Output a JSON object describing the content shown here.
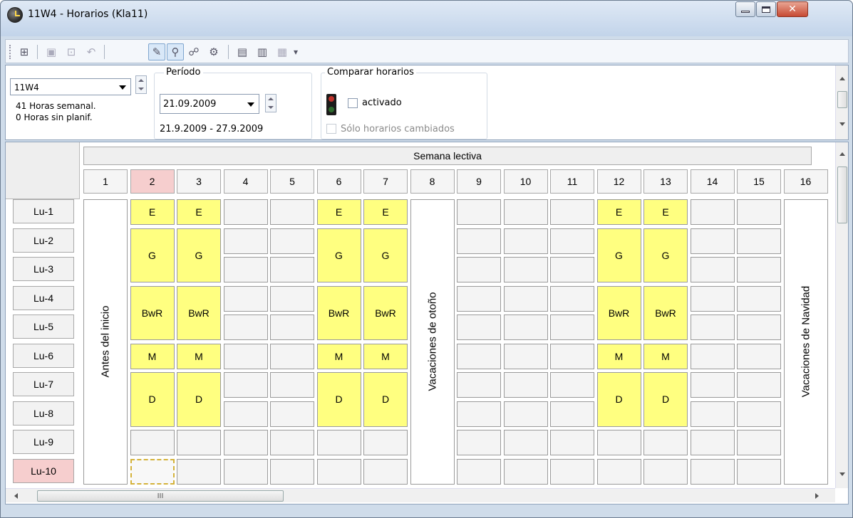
{
  "window": {
    "title": "11W4 -  Horarios  (Kla11)"
  },
  "toolbar": {
    "icons": [
      "grid-icon",
      "save-icon",
      "lock-icon",
      "undo-icon",
      "paint-icon",
      "pin-icon",
      "users-icon",
      "gear-icon",
      "report-icon",
      "export-icon",
      "layout-icon"
    ],
    "overflow": "▾"
  },
  "info": {
    "class_value": "11W4",
    "hours_weekly": "41  Horas semanal.",
    "hours_unplanned": "0  Horas sin planif.",
    "period_legend": "Período",
    "period_date": "21.09.2009",
    "period_range": "21.9.2009 - 27.9.2009",
    "compare_legend": "Comparar horarios",
    "compare_activated": "activado",
    "compare_only_changed": "Sólo horarios cambiados"
  },
  "grid": {
    "section_title": "Semana lectiva",
    "columns": [
      "1",
      "2",
      "3",
      "4",
      "5",
      "6",
      "7",
      "8",
      "9",
      "10",
      "11",
      "12",
      "13",
      "14",
      "15",
      "16"
    ],
    "selected_column": "2",
    "rows": [
      "Lu-1",
      "Lu-2",
      "Lu-3",
      "Lu-4",
      "Lu-5",
      "Lu-6",
      "Lu-7",
      "Lu-8",
      "Lu-9",
      "Lu-10"
    ],
    "selected_row": "Lu-10",
    "lessons": [
      {
        "subject": "E"
      },
      {
        "subject": "G"
      },
      {
        "subject": "BwR"
      },
      {
        "subject": "M"
      },
      {
        "subject": "D"
      }
    ],
    "holidays": {
      "col1": "Antes del inicio",
      "col8": "Vacaciones de otoño",
      "col16": "Vacaciones de Navidad"
    },
    "scroll_thumb_label": "III"
  },
  "colors": {
    "lesson": "#ffff80",
    "selected": "#f6cece"
  }
}
